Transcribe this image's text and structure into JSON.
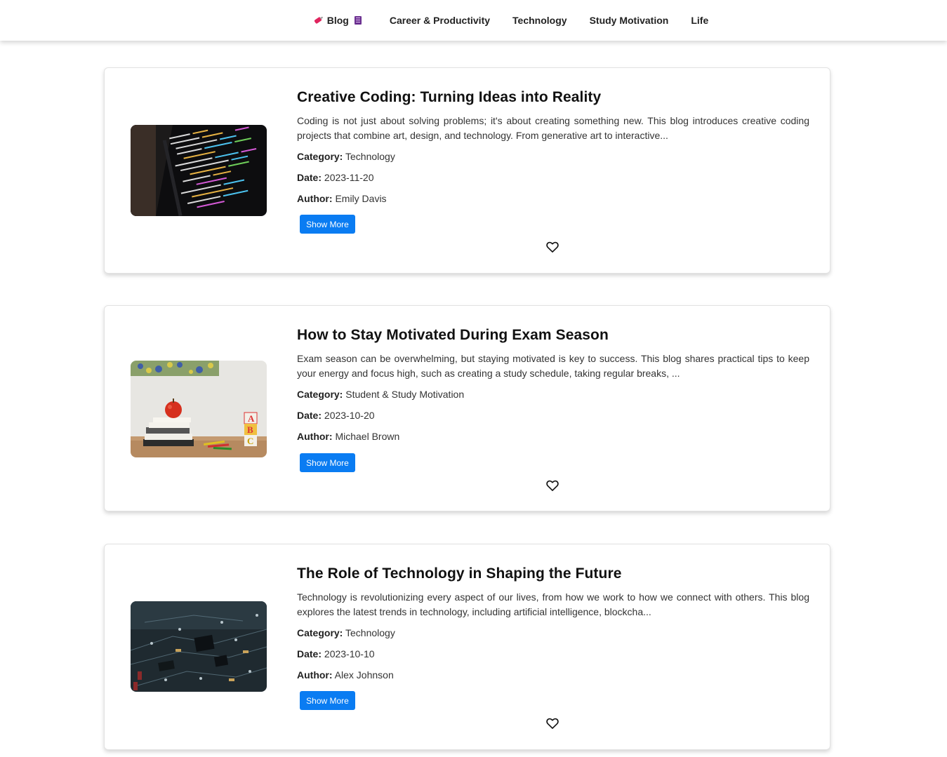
{
  "nav": {
    "brand": "Blog",
    "brand_icon_left": "pushpin-icon",
    "brand_icon_right": "book-icon",
    "links": [
      "Career & Productivity",
      "Technology",
      "Study Motivation",
      "Life"
    ]
  },
  "colors": {
    "button": "#0a7cf2",
    "card_border": "#e2e2e2"
  },
  "posts": [
    {
      "title": "Creative Coding: Turning Ideas into Reality",
      "excerpt": "Coding is not just about solving problems; it's about creating something new. This blog introduces creative coding projects that combine art, design, and technology. From generative art to interactive...",
      "category_label": "Category:",
      "category": "Technology",
      "date_label": "Date:",
      "date": "2023-11-20",
      "author_label": "Author:",
      "author": "Emily Davis",
      "button": "Show More",
      "image": "code-on-monitor-image"
    },
    {
      "title": "How to Stay Motivated During Exam Season",
      "excerpt": "Exam season can be overwhelming, but staying motivated is key to success. This blog shares practical tips to keep your energy and focus high, such as creating a study schedule, taking regular breaks, ...",
      "category_label": "Category:",
      "category": "Student & Study Motivation",
      "date_label": "Date:",
      "date": "2023-10-20",
      "author_label": "Author:",
      "author": "Michael Brown",
      "button": "Show More",
      "image": "apple-on-books-image"
    },
    {
      "title": "The Role of Technology in Shaping the Future",
      "excerpt": "Technology is revolutionizing every aspect of our lives, from how we work to how we connect with others. This blog explores the latest trends in technology, including artificial intelligence, blockcha...",
      "category_label": "Category:",
      "category": "Technology",
      "date_label": "Date:",
      "date": "2023-10-10",
      "author_label": "Author:",
      "author": "Alex Johnson",
      "button": "Show More",
      "image": "circuit-board-image"
    }
  ]
}
